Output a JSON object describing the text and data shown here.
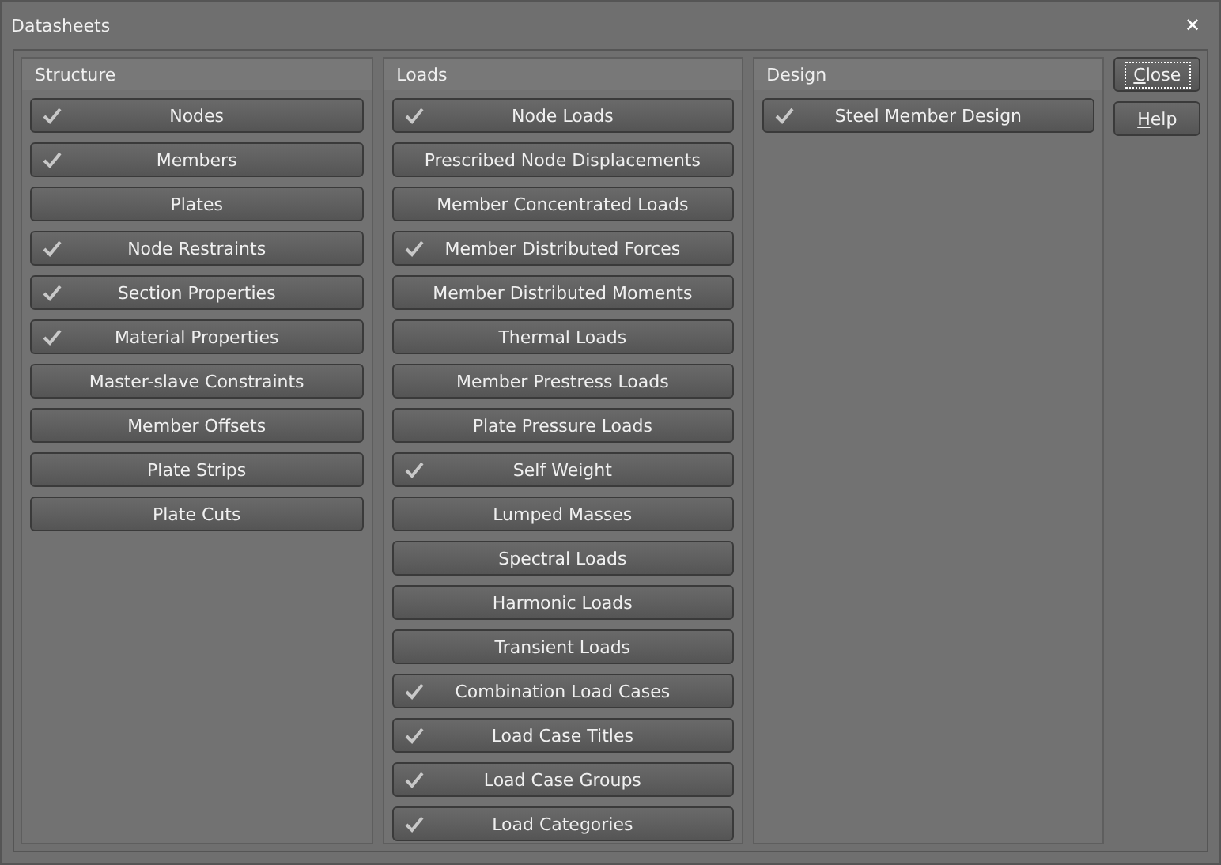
{
  "window": {
    "title": "Datasheets",
    "close": "✕"
  },
  "groups": [
    {
      "title": "Structure",
      "items": [
        {
          "label": "Nodes",
          "checked": true
        },
        {
          "label": "Members",
          "checked": true
        },
        {
          "label": "Plates",
          "checked": false
        },
        {
          "label": "Node Restraints",
          "checked": true
        },
        {
          "label": "Section Properties",
          "checked": true
        },
        {
          "label": "Material Properties",
          "checked": true
        },
        {
          "label": "Master-slave Constraints",
          "checked": false
        },
        {
          "label": "Member Offsets",
          "checked": false
        },
        {
          "label": "Plate Strips",
          "checked": false
        },
        {
          "label": "Plate Cuts",
          "checked": false
        }
      ]
    },
    {
      "title": "Loads",
      "items": [
        {
          "label": "Node Loads",
          "checked": true
        },
        {
          "label": "Prescribed Node Displacements",
          "checked": false
        },
        {
          "label": "Member Concentrated Loads",
          "checked": false
        },
        {
          "label": "Member Distributed Forces",
          "checked": true
        },
        {
          "label": "Member Distributed Moments",
          "checked": false
        },
        {
          "label": "Thermal Loads",
          "checked": false
        },
        {
          "label": "Member Prestress Loads",
          "checked": false
        },
        {
          "label": "Plate Pressure Loads",
          "checked": false
        },
        {
          "label": "Self Weight",
          "checked": true
        },
        {
          "label": "Lumped Masses",
          "checked": false
        },
        {
          "label": "Spectral Loads",
          "checked": false
        },
        {
          "label": "Harmonic Loads",
          "checked": false
        },
        {
          "label": "Transient Loads",
          "checked": false
        },
        {
          "label": "Combination Load Cases",
          "checked": true
        },
        {
          "label": "Load Case Titles",
          "checked": true
        },
        {
          "label": "Load Case Groups",
          "checked": true
        },
        {
          "label": "Load Categories",
          "checked": true
        }
      ]
    },
    {
      "title": "Design",
      "items": [
        {
          "label": "Steel Member Design",
          "checked": true
        }
      ]
    }
  ],
  "buttons": [
    {
      "label": "Close",
      "focused": true
    },
    {
      "label": "Help",
      "focused": false
    }
  ]
}
